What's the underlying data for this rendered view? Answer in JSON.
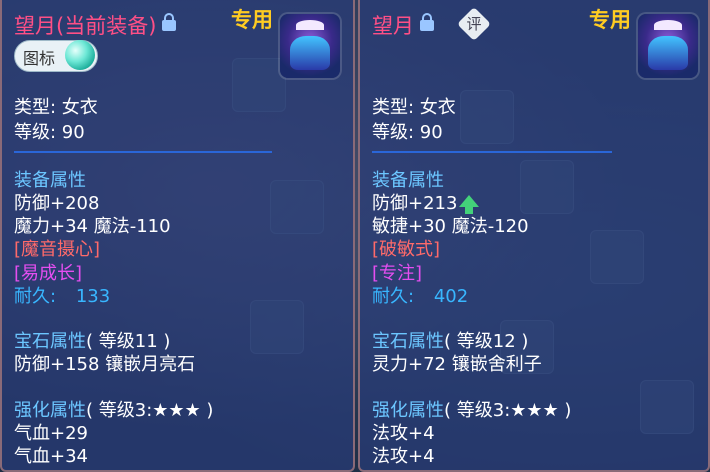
{
  "left": {
    "title": "望月(当前装备)",
    "exclusive": "专用",
    "icon_label": "图标",
    "type_line": "类型: 女衣",
    "level_line": "等级: 90",
    "equip_header": "装备属性",
    "defense": "防御+208",
    "magic_line": "魔力+34 魔法-110",
    "skill1": "[魔音摄心]",
    "skill2": "[易成长]",
    "durability_label": "耐久:",
    "durability_value": "133",
    "gem_header": "宝石属性",
    "gem_level": "( 等级11 )",
    "gem_line": "防御+158 镶嵌月亮石",
    "enhance_header": "强化属性",
    "enhance_level": "( 等级3:★★★ )",
    "enh1": "气血+29",
    "enh2": "气血+34"
  },
  "right": {
    "title": "望月",
    "exclusive": "专用",
    "eval_label": "评",
    "type_line": "类型: 女衣",
    "level_line": "等级: 90",
    "equip_header": "装备属性",
    "defense": "防御+213",
    "agility_line": "敏捷+30 魔法-120",
    "skill1": "[破敏式]",
    "skill2": "[专注]",
    "durability_label": "耐久:",
    "durability_value": "402",
    "gem_header": "宝石属性",
    "gem_level": "( 等级12 )",
    "gem_line": "灵力+72 镶嵌舍利子",
    "enhance_header": "强化属性",
    "enhance_level": "( 等级3:★★★ )",
    "enh1": "法攻+4",
    "enh2": "法攻+4"
  }
}
